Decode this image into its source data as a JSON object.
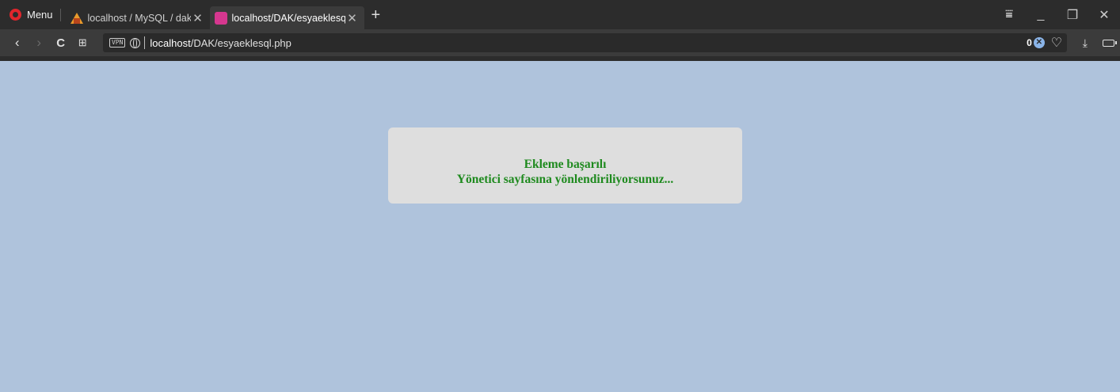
{
  "browser": {
    "menu_label": "Menu",
    "tabs": [
      {
        "title": "localhost / MySQL / dak / ",
        "favicon": "phpmyadmin-icon",
        "active": false
      },
      {
        "title": "localhost/DAK/esyaeklesql",
        "favicon": "page-favicon-icon",
        "active": true
      }
    ],
    "new_tab_symbol": "+",
    "window_controls": {
      "menu": "⩸",
      "minimize": "_",
      "restore": "❐",
      "close": "✕"
    },
    "nav": {
      "back": "‹",
      "forward": "›",
      "reload": "C",
      "speed_dial": "⊞"
    },
    "address": {
      "vpn_label": "VPN",
      "host": "localhost",
      "path": "/DAK/esyaeklesql.php",
      "tracker_count": "0"
    }
  },
  "page": {
    "message_line1": "Ekleme başarılı",
    "message_line2": "Yönetici sayfasına yönlendiriliyorsunuz...",
    "message_color": "#1e8a1e",
    "background_color": "#afc3dc",
    "box_color": "#dedede"
  }
}
